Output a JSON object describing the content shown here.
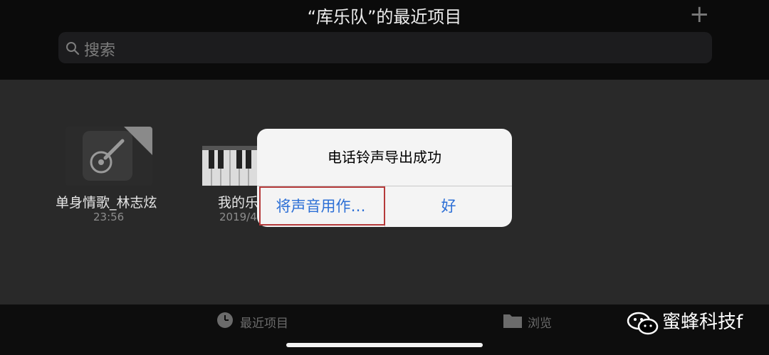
{
  "header": {
    "title": "“库乐队”的最近项目",
    "add_glyph": "+",
    "search_placeholder": "搜索"
  },
  "projects": [
    {
      "name": "单身情歌_林志炫",
      "time": "23:56",
      "icon": "guitar-icon"
    },
    {
      "name": "我的乐",
      "time": "2019/4",
      "icon": "piano-keys-icon"
    }
  ],
  "alert": {
    "title": "电话铃声导出成功",
    "left_button": "将声音用作…",
    "right_button": "好",
    "highlight_color": "#b53a3a",
    "button_color": "#2c6fd6"
  },
  "tabbar": {
    "recent_label": "最近项目",
    "browse_label": "浏览"
  },
  "watermark": {
    "text": "蜜蜂科技f",
    "icon": "wechat-icon"
  }
}
